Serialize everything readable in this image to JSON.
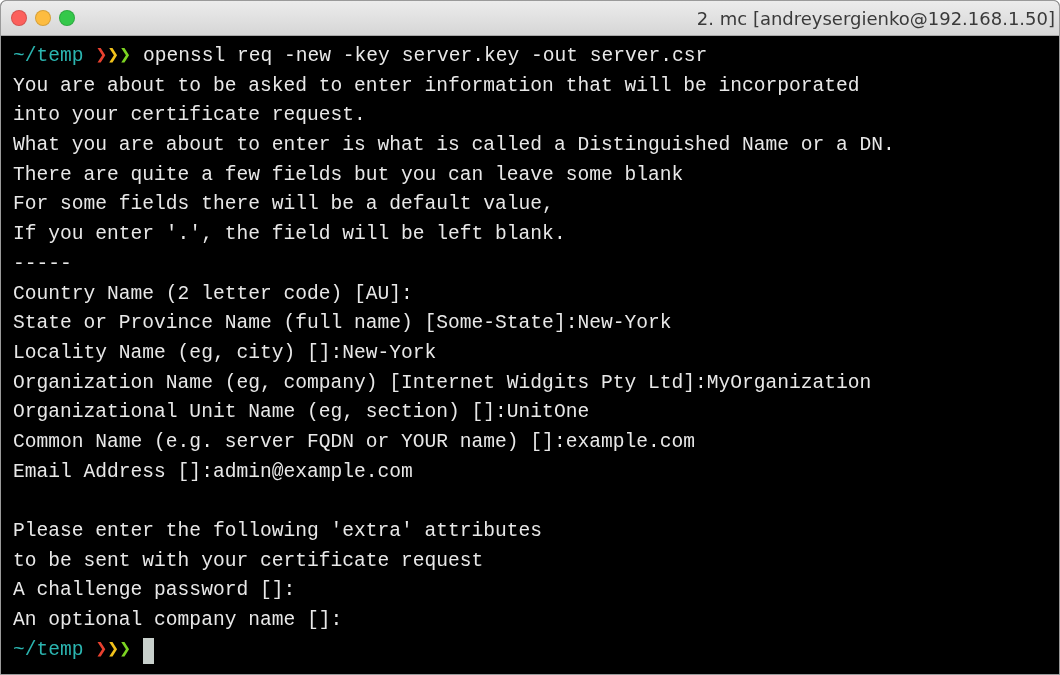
{
  "window": {
    "title": "2. mc [andreysergienko@192.168.1.50]"
  },
  "lines": [
    {
      "kind": "prompt",
      "cwd": "~/temp",
      "arrows": [
        {
          "text": "❯",
          "color": "#e8412f"
        },
        {
          "text": "❯",
          "color": "#f2c21b"
        },
        {
          "text": "❯",
          "color": "#7cd322"
        }
      ],
      "command": "openssl req -new -key server.key -out server.csr"
    },
    {
      "kind": "text",
      "text": "You are about to be asked to enter information that will be incorporated"
    },
    {
      "kind": "text",
      "text": "into your certificate request."
    },
    {
      "kind": "text",
      "text": "What you are about to enter is what is called a Distinguished Name or a DN."
    },
    {
      "kind": "text",
      "text": "There are quite a few fields but you can leave some blank"
    },
    {
      "kind": "text",
      "text": "For some fields there will be a default value,"
    },
    {
      "kind": "text",
      "text": "If you enter '.', the field will be left blank."
    },
    {
      "kind": "text",
      "text": "-----"
    },
    {
      "kind": "text",
      "text": "Country Name (2 letter code) [AU]:"
    },
    {
      "kind": "text",
      "text": "State or Province Name (full name) [Some-State]:New-York"
    },
    {
      "kind": "text",
      "text": "Locality Name (eg, city) []:New-York"
    },
    {
      "kind": "text",
      "text": "Organization Name (eg, company) [Internet Widgits Pty Ltd]:MyOrganization"
    },
    {
      "kind": "text",
      "text": "Organizational Unit Name (eg, section) []:UnitOne"
    },
    {
      "kind": "text",
      "text": "Common Name (e.g. server FQDN or YOUR name) []:example.com"
    },
    {
      "kind": "text",
      "text": "Email Address []:admin@example.com"
    },
    {
      "kind": "blank"
    },
    {
      "kind": "text",
      "text": "Please enter the following 'extra' attributes"
    },
    {
      "kind": "text",
      "text": "to be sent with your certificate request"
    },
    {
      "kind": "text",
      "text": "A challenge password []:"
    },
    {
      "kind": "text",
      "text": "An optional company name []:"
    },
    {
      "kind": "prompt",
      "cwd": "~/temp",
      "arrows": [
        {
          "text": "❯",
          "color": "#e8412f"
        },
        {
          "text": "❯",
          "color": "#f2c21b"
        },
        {
          "text": "❯",
          "color": "#7cd322"
        }
      ],
      "cursor": true
    }
  ]
}
